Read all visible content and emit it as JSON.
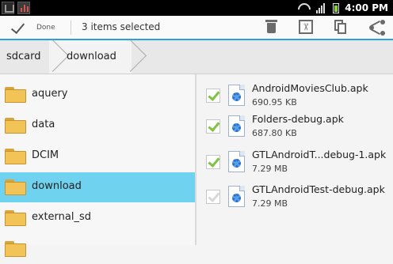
{
  "status_bar": {
    "time": "4:00 PM"
  },
  "action_bar": {
    "done_label": "Done",
    "selection_text": "3 items selected",
    "actions": [
      "delete",
      "cut",
      "copy",
      "share"
    ]
  },
  "breadcrumb": {
    "items": [
      "sdcard",
      "download"
    ]
  },
  "folders": [
    {
      "label": "aquery",
      "selected": false
    },
    {
      "label": "data",
      "selected": false
    },
    {
      "label": "DCIM",
      "selected": false
    },
    {
      "label": "download",
      "selected": true
    },
    {
      "label": "external_sd",
      "selected": false
    }
  ],
  "files": [
    {
      "name": "AndroidMoviesClub.apk",
      "size": "690.95 KB",
      "checked": true
    },
    {
      "name": "Folders-debug.apk",
      "size": "687.80 KB",
      "checked": true
    },
    {
      "name": "GTLAndroidT...debug-1.apk",
      "size": "7.29 MB",
      "checked": true
    },
    {
      "name": "GTLAndroidTest-debug.apk",
      "size": "7.29 MB",
      "checked": false
    }
  ],
  "colors": {
    "accent": "#2a9fd8",
    "selected_folder": "#6fd3ef",
    "check_green": "#7cc442"
  }
}
